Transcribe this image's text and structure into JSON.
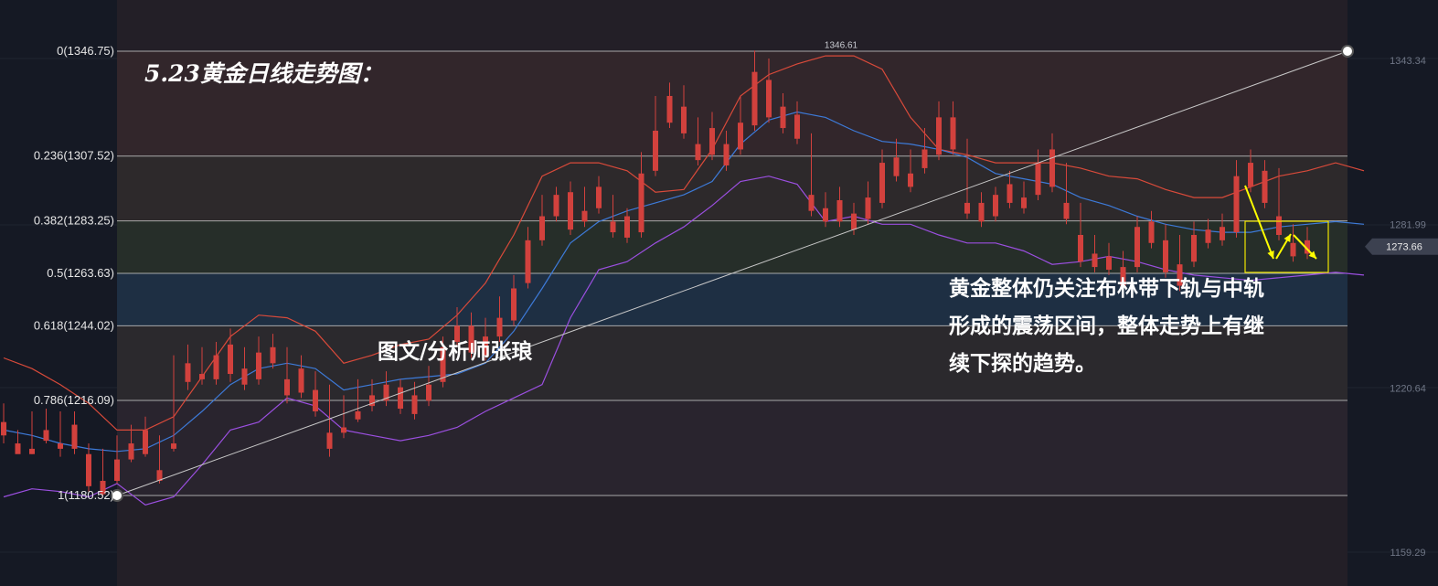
{
  "chart_data": {
    "type": "candlestick",
    "title": "5.23黄金日线走势图：",
    "author": "图文/分析师张琅",
    "annotation": [
      "黄金整体仍关注布林带下轨与中轨",
      "形成的震荡区间，整体走势上有继",
      "续下探的趋势。"
    ],
    "ylim": [
      1150,
      1360
    ],
    "fib_levels": [
      {
        "label": "0(1346.75)",
        "value": 1346.75
      },
      {
        "label": "0.236(1307.52)",
        "value": 1307.52
      },
      {
        "label": "0.382(1283.25)",
        "value": 1283.25
      },
      {
        "label": "0.5(1263.63)",
        "value": 1263.63
      },
      {
        "label": "0.618(1244.02)",
        "value": 1244.02
      },
      {
        "label": "0.786(1216.09)",
        "value": 1216.09
      },
      {
        "label": "1(1180.52)",
        "value": 1180.52
      }
    ],
    "price_ticks": [
      "1343.34",
      "1281.99",
      "1220.64",
      "1159.29"
    ],
    "price_tick_values": [
      1343.34,
      1281.99,
      1220.64,
      1159.29
    ],
    "current_price": "1273.66",
    "current_price_value": 1273.66,
    "peak_label": "1346.61",
    "peak_value": 1346.61,
    "colors": {
      "up": "#5fa83a",
      "down": "#d2413d",
      "upper_band": "#d94a3a",
      "middle_band": "#3d7ad8",
      "lower_band": "#9b4fe0",
      "trendline": "#c8c8c8",
      "highlight": "#f0e600",
      "arrow": "#ffff00"
    },
    "bollinger": {
      "upper": [
        1232,
        1228,
        1222,
        1215,
        1205,
        1205,
        1210,
        1225,
        1240,
        1248,
        1247,
        1242,
        1230,
        1233,
        1237,
        1239,
        1248,
        1260,
        1278,
        1300,
        1305,
        1305,
        1302,
        1294,
        1295,
        1310,
        1330,
        1338,
        1342,
        1345,
        1345,
        1340,
        1322,
        1310,
        1308,
        1305,
        1305,
        1305,
        1303,
        1300,
        1299,
        1295,
        1292,
        1292,
        1296,
        1300,
        1302,
        1305,
        1302
      ],
      "middle": [
        1205,
        1203,
        1200,
        1198,
        1197,
        1198,
        1203,
        1212,
        1222,
        1228,
        1230,
        1228,
        1220,
        1222,
        1224,
        1225,
        1226,
        1230,
        1242,
        1258,
        1275,
        1283,
        1287,
        1290,
        1293,
        1298,
        1312,
        1321,
        1324,
        1322,
        1317,
        1313,
        1312,
        1310,
        1307,
        1301,
        1299,
        1297,
        1292,
        1289,
        1285,
        1282,
        1280,
        1279,
        1279,
        1281,
        1282,
        1283,
        1282
      ],
      "lower": [
        1180,
        1183,
        1182,
        1180,
        1185,
        1177,
        1180,
        1192,
        1205,
        1208,
        1217,
        1214,
        1205,
        1203,
        1201,
        1203,
        1206,
        1212,
        1217,
        1222,
        1247,
        1265,
        1268,
        1275,
        1281,
        1289,
        1298,
        1300,
        1297,
        1283,
        1285,
        1282,
        1282,
        1278,
        1275,
        1275,
        1272,
        1267,
        1268,
        1270,
        1268,
        1265,
        1263,
        1262,
        1261,
        1262,
        1263,
        1264,
        1263
      ]
    },
    "candles": [
      [
        1208,
        1215,
        1203,
        1200
      ],
      [
        1200,
        1205,
        1196,
        1198
      ],
      [
        1198,
        1212,
        1196,
        1196
      ],
      [
        1205,
        1213,
        1201,
        1200
      ],
      [
        1200,
        1212,
        1198,
        1195
      ],
      [
        1207,
        1212,
        1198,
        1196
      ],
      [
        1196,
        1200,
        1184,
        1182
      ],
      [
        1186,
        1198,
        1181,
        1180
      ],
      [
        1194,
        1203,
        1186,
        1185
      ],
      [
        1200,
        1207,
        1194,
        1193
      ],
      [
        1205,
        1210,
        1196,
        1195
      ],
      [
        1190,
        1203,
        1186,
        1185
      ],
      [
        1200,
        1233,
        1198,
        1197
      ],
      [
        1230,
        1237,
        1223,
        1220
      ],
      [
        1226,
        1236,
        1224,
        1222
      ],
      [
        1233,
        1238,
        1224,
        1222
      ],
      [
        1237,
        1243,
        1226,
        1223
      ],
      [
        1228,
        1236,
        1222,
        1220
      ],
      [
        1234,
        1240,
        1224,
        1222
      ],
      [
        1236,
        1241,
        1230,
        1228
      ],
      [
        1224,
        1236,
        1218,
        1215
      ],
      [
        1228,
        1233,
        1219,
        1217
      ],
      [
        1220,
        1227,
        1212,
        1210
      ],
      [
        1204,
        1222,
        1198,
        1195
      ],
      [
        1206,
        1218,
        1204,
        1202
      ],
      [
        1212,
        1224,
        1209,
        1208
      ],
      [
        1218,
        1224,
        1214,
        1212
      ],
      [
        1222,
        1227,
        1216,
        1214
      ],
      [
        1221,
        1224,
        1213,
        1211
      ],
      [
        1218,
        1223,
        1211,
        1209
      ],
      [
        1222,
        1229,
        1216,
        1214
      ],
      [
        1236,
        1240,
        1223,
        1221
      ],
      [
        1244,
        1251,
        1238,
        1236
      ],
      [
        1244,
        1249,
        1234,
        1232
      ],
      [
        1240,
        1247,
        1233,
        1231
      ],
      [
        1247,
        1255,
        1240,
        1238
      ],
      [
        1258,
        1263,
        1246,
        1244
      ],
      [
        1276,
        1281,
        1260,
        1258
      ],
      [
        1285,
        1293,
        1276,
        1274
      ],
      [
        1293,
        1296,
        1285,
        1283
      ],
      [
        1294,
        1298,
        1280,
        1278
      ],
      [
        1287,
        1296,
        1283,
        1281
      ],
      [
        1296,
        1300,
        1288,
        1286
      ],
      [
        1283,
        1293,
        1279,
        1277
      ],
      [
        1285,
        1288,
        1277,
        1275
      ],
      [
        1301,
        1309,
        1279,
        1277
      ],
      [
        1317,
        1330,
        1302,
        1300
      ],
      [
        1330,
        1335,
        1320,
        1318
      ],
      [
        1326,
        1334,
        1316,
        1314
      ],
      [
        1312,
        1322,
        1306,
        1304
      ],
      [
        1318,
        1324,
        1308,
        1306
      ],
      [
        1312,
        1317,
        1304,
        1302
      ],
      [
        1320,
        1330,
        1310,
        1308
      ],
      [
        1339,
        1347,
        1319,
        1317
      ],
      [
        1336,
        1344,
        1322,
        1320
      ],
      [
        1326,
        1331,
        1318,
        1316
      ],
      [
        1323,
        1328,
        1314,
        1312
      ],
      [
        1293,
        1316,
        1287,
        1285
      ],
      [
        1288,
        1294,
        1283,
        1281
      ],
      [
        1291,
        1296,
        1283,
        1281
      ],
      [
        1286,
        1290,
        1280,
        1278
      ],
      [
        1292,
        1298,
        1284,
        1282
      ],
      [
        1305,
        1310,
        1290,
        1288
      ],
      [
        1307,
        1314,
        1300,
        1298
      ],
      [
        1301,
        1310,
        1296,
        1294
      ],
      [
        1310,
        1318,
        1303,
        1301
      ],
      [
        1322,
        1328,
        1308,
        1306
      ],
      [
        1322,
        1328,
        1310,
        1308
      ],
      [
        1290,
        1314,
        1286,
        1284
      ],
      [
        1290,
        1294,
        1283,
        1281
      ],
      [
        1293,
        1296,
        1285,
        1283
      ],
      [
        1297,
        1302,
        1290,
        1288
      ],
      [
        1292,
        1298,
        1288,
        1286
      ],
      [
        1305,
        1310,
        1293,
        1291
      ],
      [
        1310,
        1316,
        1296,
        1294
      ],
      [
        1290,
        1305,
        1284,
        1282
      ],
      [
        1278,
        1290,
        1268,
        1266
      ],
      [
        1271,
        1278,
        1266,
        1264
      ],
      [
        1270,
        1275,
        1265,
        1263
      ],
      [
        1266,
        1272,
        1259,
        1257
      ],
      [
        1281,
        1285,
        1266,
        1264
      ],
      [
        1283,
        1287,
        1275,
        1273
      ],
      [
        1276,
        1282,
        1264,
        1262
      ],
      [
        1267,
        1278,
        1259,
        1257
      ],
      [
        1278,
        1283,
        1268,
        1266
      ],
      [
        1280,
        1284,
        1275,
        1273
      ],
      [
        1281,
        1286,
        1276,
        1274
      ],
      [
        1300,
        1306,
        1279,
        1277
      ],
      [
        1305,
        1310,
        1296,
        1294
      ],
      [
        1302,
        1306,
        1290,
        1288
      ],
      [
        1285,
        1303,
        1278,
        1276
      ],
      [
        1275,
        1282,
        1270,
        1268
      ],
      [
        1276,
        1281,
        1271,
        1269
      ]
    ]
  }
}
